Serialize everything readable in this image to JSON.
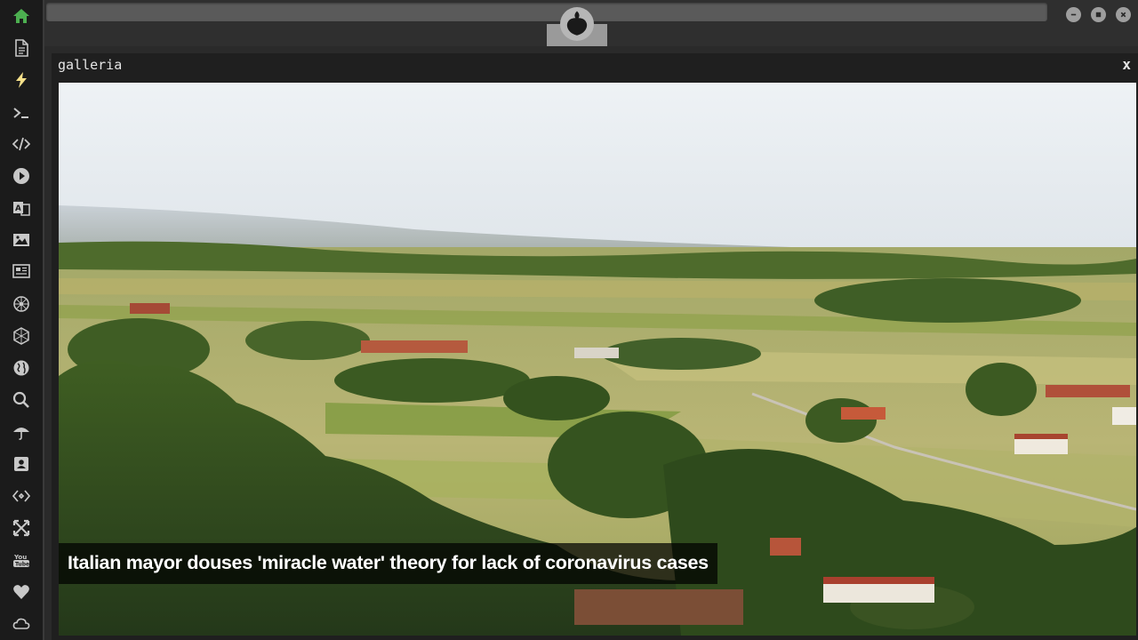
{
  "panel": {
    "title": "galleria",
    "close_label": "x"
  },
  "gallery": {
    "caption": "Italian mayor douses 'miracle water' theory for lack of coronavirus cases"
  },
  "sidebar": {
    "items": [
      {
        "icon": "home-icon",
        "active": true
      },
      {
        "icon": "document-icon"
      },
      {
        "icon": "lightning-icon",
        "active": true
      },
      {
        "icon": "terminal-icon"
      },
      {
        "icon": "code-icon"
      },
      {
        "icon": "play-icon"
      },
      {
        "icon": "translate-icon"
      },
      {
        "icon": "image-icon"
      },
      {
        "icon": "newspaper-icon"
      },
      {
        "icon": "settings-wheel-icon"
      },
      {
        "icon": "hexagon-icon"
      },
      {
        "icon": "globe-icon"
      },
      {
        "icon": "search-icon"
      },
      {
        "icon": "umbrella-icon"
      },
      {
        "icon": "contact-card-icon"
      },
      {
        "icon": "diamond-code-icon"
      },
      {
        "icon": "expand-icon"
      },
      {
        "icon": "youtube-icon"
      },
      {
        "icon": "heart-icon"
      },
      {
        "icon": "cloud-icon"
      }
    ]
  },
  "colors": {
    "accent_green": "#4caf50",
    "accent_yellow": "#f5e08a",
    "icon_gray": "#c8c8c8"
  }
}
